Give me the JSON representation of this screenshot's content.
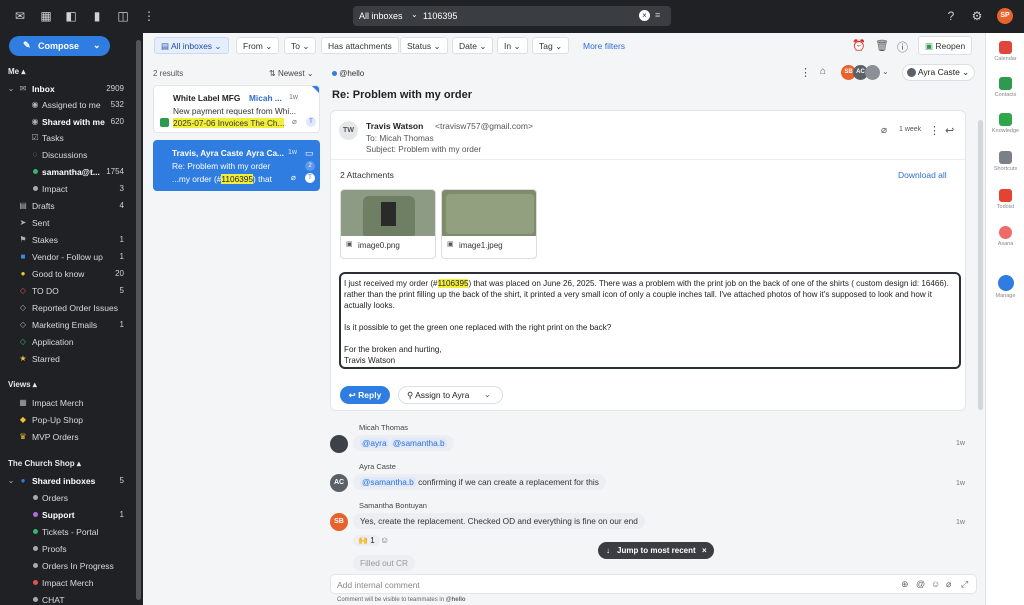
{
  "topbar": {
    "search_scope": "All inboxes",
    "search_query": "1106395",
    "user_initials": "SP"
  },
  "sidebar": {
    "compose": "Compose",
    "me_label": "Me",
    "items": [
      {
        "label": "Inbox",
        "count": "2909"
      },
      {
        "label": "Assigned to me",
        "count": "532"
      },
      {
        "label": "Shared with me",
        "count": "620"
      },
      {
        "label": "Tasks",
        "count": ""
      },
      {
        "label": "Discussions",
        "count": ""
      },
      {
        "label": "samantha@t...",
        "count": "1754"
      },
      {
        "label": "Impact",
        "count": "3"
      },
      {
        "label": "Drafts",
        "count": "4"
      },
      {
        "label": "Sent",
        "count": ""
      },
      {
        "label": "Stakes",
        "count": "1"
      },
      {
        "label": "Vendor - Follow up",
        "count": "1"
      },
      {
        "label": "Good to know",
        "count": "20"
      },
      {
        "label": "TO DO",
        "count": "5"
      },
      {
        "label": "Reported Order Issues",
        "count": ""
      },
      {
        "label": "Marketing Emails",
        "count": "1"
      },
      {
        "label": "Application",
        "count": ""
      },
      {
        "label": "Starred",
        "count": ""
      }
    ],
    "views_label": "Views",
    "views": [
      {
        "label": "Impact Merch"
      },
      {
        "label": "Pop-Up Shop"
      },
      {
        "label": "MVP Orders"
      }
    ],
    "church_label": "The Church Shop",
    "shared_inboxes": {
      "label": "Shared inboxes",
      "count": "5"
    },
    "church_items": [
      {
        "label": "Orders",
        "count": ""
      },
      {
        "label": "Support",
        "count": "1"
      },
      {
        "label": "Tickets - Portal",
        "count": ""
      },
      {
        "label": "Proofs",
        "count": ""
      },
      {
        "label": "Orders In Progress",
        "count": ""
      },
      {
        "label": "Impact Merch",
        "count": ""
      },
      {
        "label": "CHAT",
        "count": ""
      }
    ]
  },
  "filters": {
    "all_inboxes": "All inboxes",
    "from": "From",
    "to": "To",
    "has_attachments": "Has attachments",
    "status": "Status",
    "date": "Date",
    "in": "In",
    "tag": "Tag",
    "more": "More filters",
    "reopen": "Reopen"
  },
  "list": {
    "results": "2 results",
    "sort": "Newest",
    "items": [
      {
        "sender": "White Label MFG",
        "tag": "Micah ...",
        "time": "1w",
        "line1": "New payment request from Whi...",
        "line2": "2025-07-06 Invoices The Ch..."
      },
      {
        "sender": "Travis, Ayra Caste",
        "tag": "Ayra Ca...",
        "time": "1w",
        "line1": "Re: Problem with my order",
        "line2_pre": "...my order (#",
        "line2_hl": "1106395",
        "line2_post": ") that",
        "badge": "2"
      }
    ]
  },
  "reading": {
    "inbox_tag": "@hello",
    "subject": "Re: Problem with my order",
    "assignee": "Ayra Caste",
    "avatars": [
      "SB",
      "AC"
    ],
    "message": {
      "from_name": "Travis Watson",
      "from_email": "<travisw757@gmail.com>",
      "to": "To: Micah Thomas",
      "subject_line": "Subject: Problem with my order",
      "time": "1 week",
      "initials": "TW",
      "attachments_label": "2 Attachments",
      "download_all": "Download all",
      "attachments": [
        {
          "name": "image0.png"
        },
        {
          "name": "image1.jpeg"
        }
      ],
      "body_p1_pre": "I just received my order (#",
      "body_p1_hl": "1106395",
      "body_p1_post": ") that was placed on June 26, 2025. There was a problem with the print job on the back of one of the shirts ( custom design id: 16466). rather than the print filling up the back of the shirt, it printed a very small icon of only a couple inches tall. I've attached photos of how it's supposed to look and how it actually looks.",
      "body_p2": "Is it possible to get the green one replaced with the right print on the back?",
      "body_p3": "For the broken and hurting,",
      "body_p4": "Travis Watson",
      "reply": "Reply",
      "assign": "Assign to Ayra"
    },
    "comments": [
      {
        "author": "Micah Thomas",
        "m1": "@ayra",
        "m2": "@samantha.b",
        "text": "",
        "time": "1w"
      },
      {
        "author": "Ayra Caste",
        "initials": "AC",
        "m1": "@samantha.b",
        "text": "confirming if we can create a replacement for this",
        "time": "1w"
      },
      {
        "author": "Samantha Bontuyan",
        "initials": "SB",
        "text": "Yes, create the replacement. Checked OD and everything is fine on our end",
        "time": "1w",
        "reaction": "1",
        "partial": "Filled out CR"
      }
    ],
    "jump": "Jump to most recent",
    "composer_placeholder": "Add internal comment",
    "composer_hint_pre": "Comment will be visible to teammates in",
    "composer_hint_inbox": "@hello"
  },
  "rightrail": [
    {
      "label": "Calendar"
    },
    {
      "label": "Contacts"
    },
    {
      "label": "Knowledge"
    },
    {
      "label": "Shortcuts"
    },
    {
      "label": "Todoist"
    },
    {
      "label": "Asana"
    },
    {
      "label": "Manage"
    }
  ],
  "colors": {
    "accent": "#2f7de1",
    "sidebar": "#1f2124",
    "highlight": "#f2ef3a"
  }
}
